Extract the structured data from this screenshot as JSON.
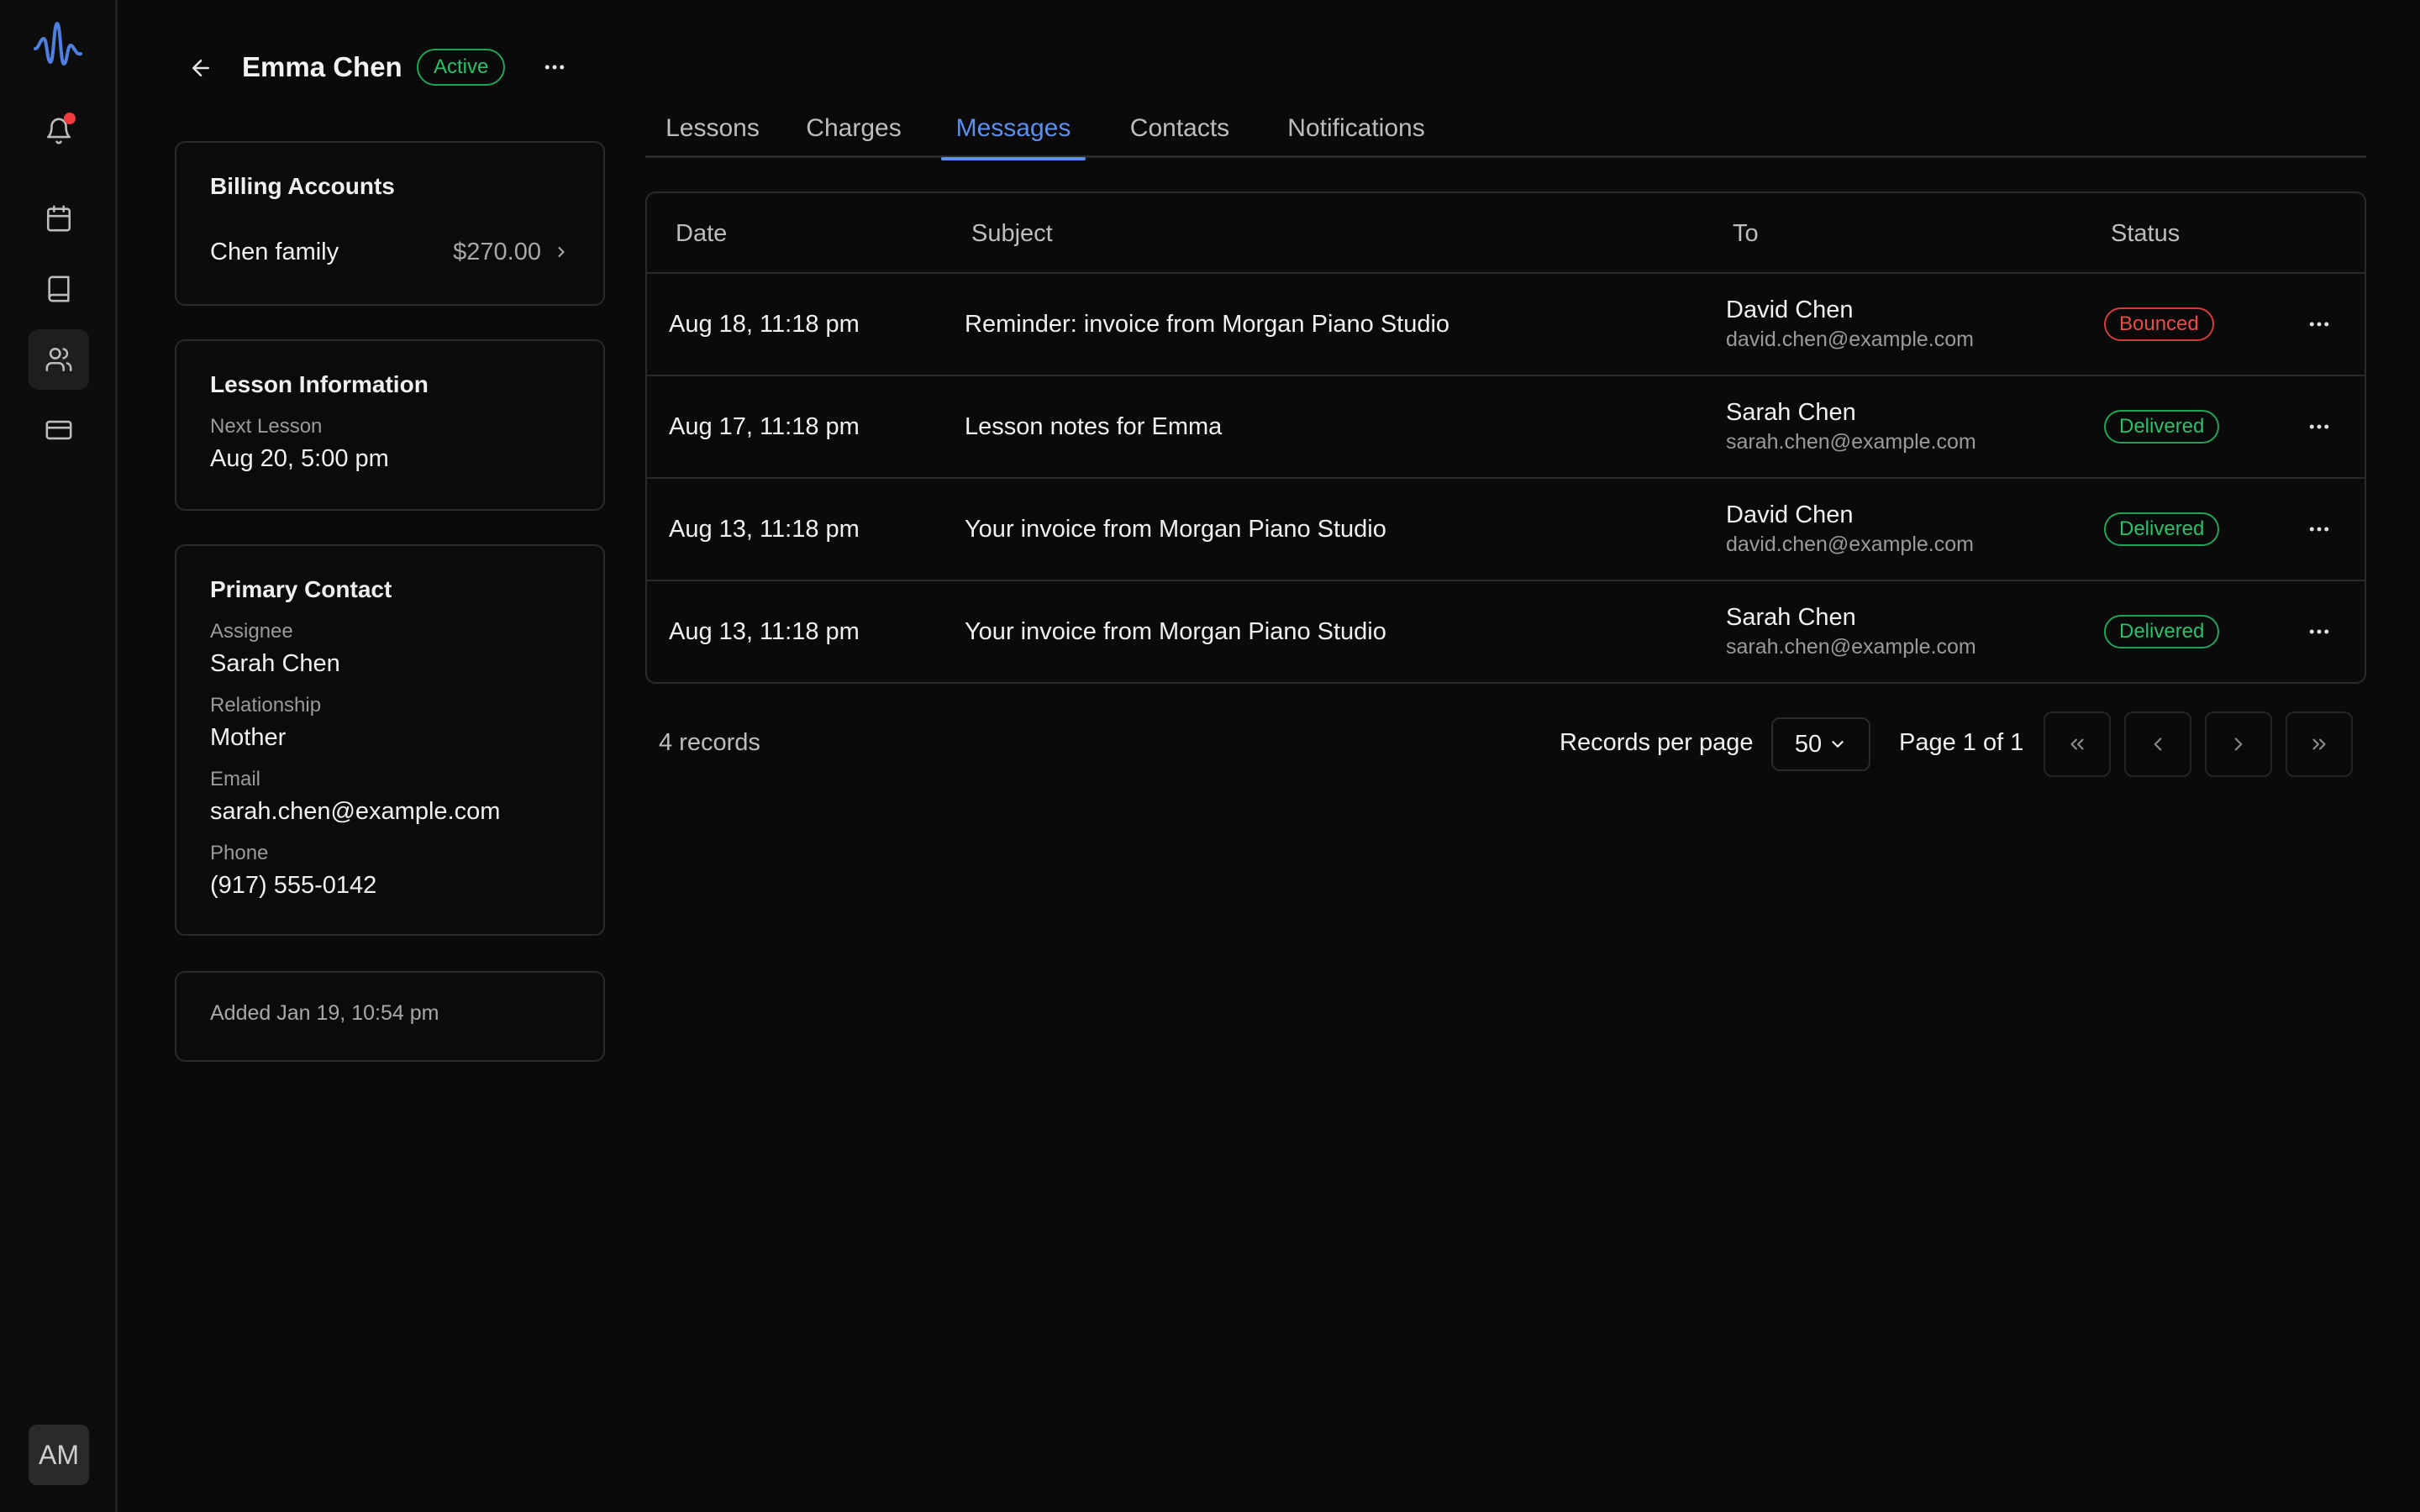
{
  "header": {
    "title": "Emma Chen",
    "status": "Active"
  },
  "sidebar": {
    "items": [
      {
        "icon": "logo-icon"
      },
      {
        "icon": "bell-icon",
        "has_notification": true
      },
      {
        "icon": "calendar-icon"
      },
      {
        "icon": "book-icon"
      },
      {
        "icon": "users-icon",
        "active": true
      },
      {
        "icon": "credit-card-icon"
      }
    ],
    "avatar_initials": "AM"
  },
  "billing": {
    "title": "Billing Accounts",
    "account_name": "Chen family",
    "amount": "$270.00"
  },
  "lesson_info": {
    "title": "Lesson Information",
    "next_label": "Next Lesson",
    "next_value": "Aug 20, 5:00 pm"
  },
  "primary_contact": {
    "title": "Primary Contact",
    "assignee_label": "Assignee",
    "assignee_value": "Sarah Chen",
    "relationship_label": "Relationship",
    "relationship_value": "Mother",
    "email_label": "Email",
    "email_value": "sarah.chen@example.com",
    "phone_label": "Phone",
    "phone_value": "(917) 555-0142"
  },
  "added": "Added Jan 19, 10:54 pm",
  "tabs": [
    {
      "label": "Lessons"
    },
    {
      "label": "Charges"
    },
    {
      "label": "Messages",
      "active": true
    },
    {
      "label": "Contacts"
    },
    {
      "label": "Notifications"
    }
  ],
  "table": {
    "headers": {
      "date": "Date",
      "subject": "Subject",
      "to": "To",
      "status": "Status"
    },
    "rows": [
      {
        "date": "Aug 18, 11:18 pm",
        "subject": "Reminder: invoice from Morgan Piano Studio",
        "to_name": "David Chen",
        "to_email": "david.chen@example.com",
        "status": "Bounced"
      },
      {
        "date": "Aug 17, 11:18 pm",
        "subject": "Lesson notes for Emma",
        "to_name": "Sarah Chen",
        "to_email": "sarah.chen@example.com",
        "status": "Delivered"
      },
      {
        "date": "Aug 13, 11:18 pm",
        "subject": "Your invoice from Morgan Piano Studio",
        "to_name": "David Chen",
        "to_email": "david.chen@example.com",
        "status": "Delivered"
      },
      {
        "date": "Aug 13, 11:18 pm",
        "subject": "Your invoice from Morgan Piano Studio",
        "to_name": "Sarah Chen",
        "to_email": "sarah.chen@example.com",
        "status": "Delivered"
      }
    ]
  },
  "pagination": {
    "records_count": "4 records",
    "records_per_page_label": "Records per page",
    "records_per_page_value": "50",
    "page_label": "Page 1 of 1"
  }
}
